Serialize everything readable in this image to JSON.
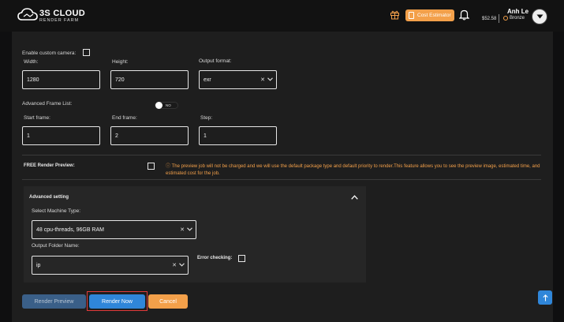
{
  "header": {
    "logo_title": "3S CLOUD",
    "logo_subtitle": "RENDER FARM",
    "cost_estimator_label": "Cost Estimator",
    "balance": "$52.58",
    "user_name": "Anh Le",
    "tier": "Bronze"
  },
  "form": {
    "custom_camera_label": "Enable custom camera:",
    "width_label": "Width:",
    "width_value": "1280",
    "height_label": "Height:",
    "height_value": "720",
    "output_format_label": "Output format:",
    "output_format_value": "exr",
    "frame_list_label": "Advanced Frame List:",
    "frame_list_toggle": "NO",
    "start_frame_label": "Start frame:",
    "start_frame_value": "1",
    "end_frame_label": "End frame:",
    "end_frame_value": "2",
    "step_label": "Step:",
    "step_value": "1",
    "free_preview_label": "FREE Render Preview:",
    "free_preview_notice": "The preview job will not be charged and we will use the default package type and default priority to render.This feature allows you to see the preview image, estimated time, and estimated cost for the job."
  },
  "advanced": {
    "title": "Advanced setting",
    "machine_label": "Select Machine Type:",
    "machine_value": "48 cpu-threads, 96GB RAM",
    "folder_label": "Output Folder Name:",
    "folder_value": "ip",
    "error_label": "Error checking:"
  },
  "actions": {
    "preview_label": "Render Preview",
    "render_label": "Render Now",
    "cancel_label": "Cancel"
  },
  "colors": {
    "accent_orange": "#f3a04a",
    "primary_blue": "#2f86d9",
    "highlight_red": "#e13a3a"
  }
}
